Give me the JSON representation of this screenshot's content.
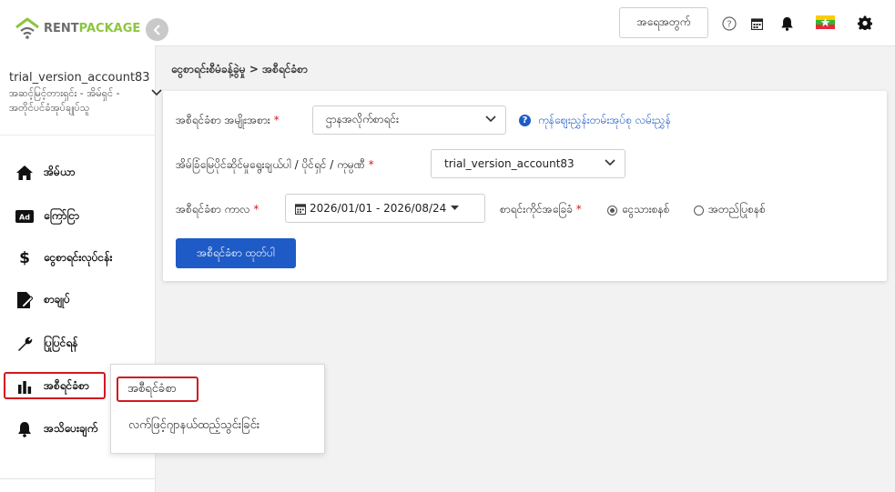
{
  "sidebar": {
    "logo": {
      "rent": "RENT",
      "package": "PACKAGE"
    },
    "account": {
      "name": "trial_version_account83",
      "role": "အဆင့်မြင့်တားရှင်း - အိမ်ရှင် - အတိုင်ပင်ခံအုပ်ချုပ်သူ"
    },
    "items": [
      {
        "label": "အိမ်ယာ",
        "icon": "home-icon"
      },
      {
        "label": "ကြော်ငြာ",
        "icon": "ad-icon"
      },
      {
        "label": "ငွေစာရင်းလုပ်ငန်း",
        "icon": "dollar-icon"
      },
      {
        "label": "စာချုပ်",
        "icon": "contract-icon"
      },
      {
        "label": "ပြုပြင်ရန်",
        "icon": "wrench-icon"
      },
      {
        "label": "အစီရင်ခံစာ",
        "icon": "bar-chart-icon"
      },
      {
        "label": "အသိပေးချက်",
        "icon": "bell-icon"
      }
    ]
  },
  "topbar": {
    "search_button": "အရေအတွက်",
    "flag": "Myanmar"
  },
  "breadcrumb": {
    "parent": "ငွေစာရင်းစီမံခန့်ခွဲမှု",
    "separator": ">",
    "current": "အစီရင်ခံစာ"
  },
  "form": {
    "report_type_label": "အစီရင်ခံစာ အမျိုးအစား",
    "report_type_value": "ဌာနအလိုက်စာရင်း",
    "help_link": "ကုန်ဈေးညွှန်းတမ်းအုပ်စု လမ်းညွှန်",
    "property_label": "အိမ်ခြံမြေပိုင်ဆိုင်မှုရွေးချယ်ပါ / ပိုင်ရှင် / ကုမ္ပဏီ",
    "property_value": "trial_version_account83",
    "period_label": "အစီရင်ခံစာ ကာလ",
    "period_value": "2026/01/01 - 2026/08/24",
    "basis_label": "စာရင်းကိုင်အခြေခံ",
    "basis_options": [
      {
        "label": "ငွေသားစနစ်",
        "selected": true
      },
      {
        "label": "အတည်ပြုစနစ်",
        "selected": false
      }
    ],
    "submit_label": "အစီရင်ခံစာ ထုတ်ပါ",
    "required_mark": "*"
  },
  "popup": {
    "items": [
      {
        "label": "အစီရင်ခံစာ",
        "selected": true
      },
      {
        "label": "လက်ဖြင့်ဂျာနယ်ထည့်သွင်းခြင်း",
        "selected": false
      }
    ]
  },
  "colors": {
    "primary": "#1f5bc6",
    "highlight_border": "#d0191f",
    "logo_green": "#8cc63f",
    "background": "#f2f2f2"
  }
}
